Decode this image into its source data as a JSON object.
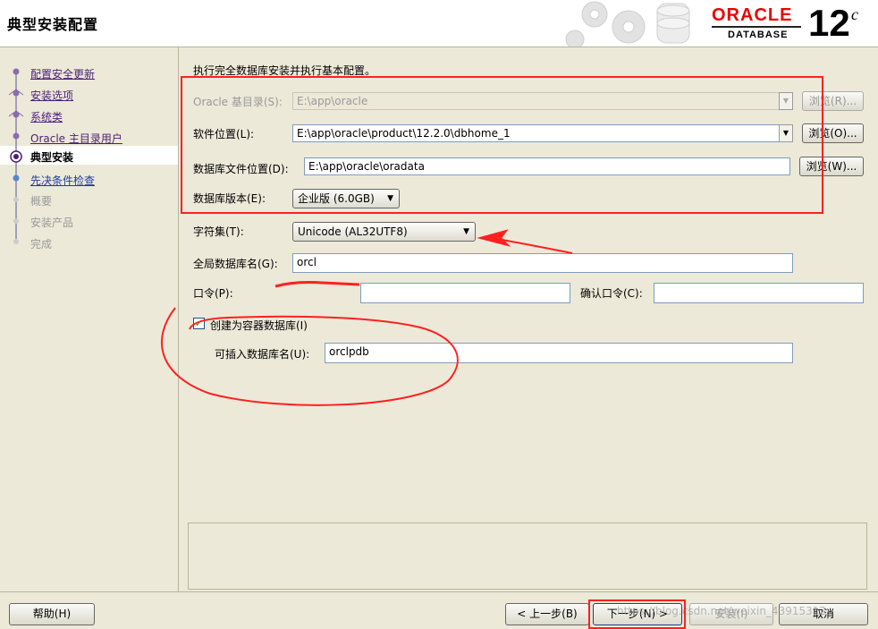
{
  "window": {
    "title": "典型安装配置"
  },
  "logo": {
    "brand": "ORACLE",
    "product": "DATABASE",
    "version": "12",
    "version_suffix": "c"
  },
  "steps": [
    {
      "label": "配置安全更新",
      "state": "done"
    },
    {
      "label": "安装选项",
      "state": "done"
    },
    {
      "label": "系统类",
      "state": "done"
    },
    {
      "label": "Oracle 主目录用户",
      "state": "done"
    },
    {
      "label": "典型安装",
      "state": "current"
    },
    {
      "label": "先决条件检查",
      "state": "next"
    },
    {
      "label": "概要",
      "state": "todo"
    },
    {
      "label": "安装产品",
      "state": "todo"
    },
    {
      "label": "完成",
      "state": "todo"
    }
  ],
  "form": {
    "intro": "执行完全数据库安装并执行基本配置。",
    "oracle_base": {
      "label": "Oracle 基目录(S):",
      "value": "E:\\app\\oracle",
      "browse": "浏览(R)...",
      "enabled": false
    },
    "software_location": {
      "label": "软件位置(L):",
      "value": "E:\\app\\oracle\\product\\12.2.0\\dbhome_1",
      "browse": "浏览(O)..."
    },
    "db_file_location": {
      "label": "数据库文件位置(D):",
      "value": "E:\\app\\oracle\\oradata",
      "browse": "浏览(W)..."
    },
    "db_edition": {
      "label": "数据库版本(E):",
      "value": "企业版 (6.0GB)"
    },
    "charset": {
      "label": "字符集(T):",
      "value": "Unicode (AL32UTF8)"
    },
    "global_db_name": {
      "label": "全局数据库名(G):",
      "value": "orcl"
    },
    "password": {
      "label": "口令(P):",
      "value": ""
    },
    "confirm_password": {
      "label": "确认口令(C):",
      "value": ""
    },
    "container_db": {
      "label": "创建为容器数据库(I)",
      "checked": true
    },
    "pluggable_db_name": {
      "label": "可插入数据库名(U):",
      "value": "orclpdb"
    }
  },
  "footer": {
    "help": "帮助(H)",
    "back": "< 上一步(B)",
    "next": "下一步(N) >",
    "install": "安装(I)",
    "cancel": "取消"
  },
  "watermark": "https://blog.csdn.net/weixin_43915312",
  "colors": {
    "annotation_red": "#ff2020",
    "step_link": "#4b1e7a",
    "oracle_red": "#e00000"
  }
}
